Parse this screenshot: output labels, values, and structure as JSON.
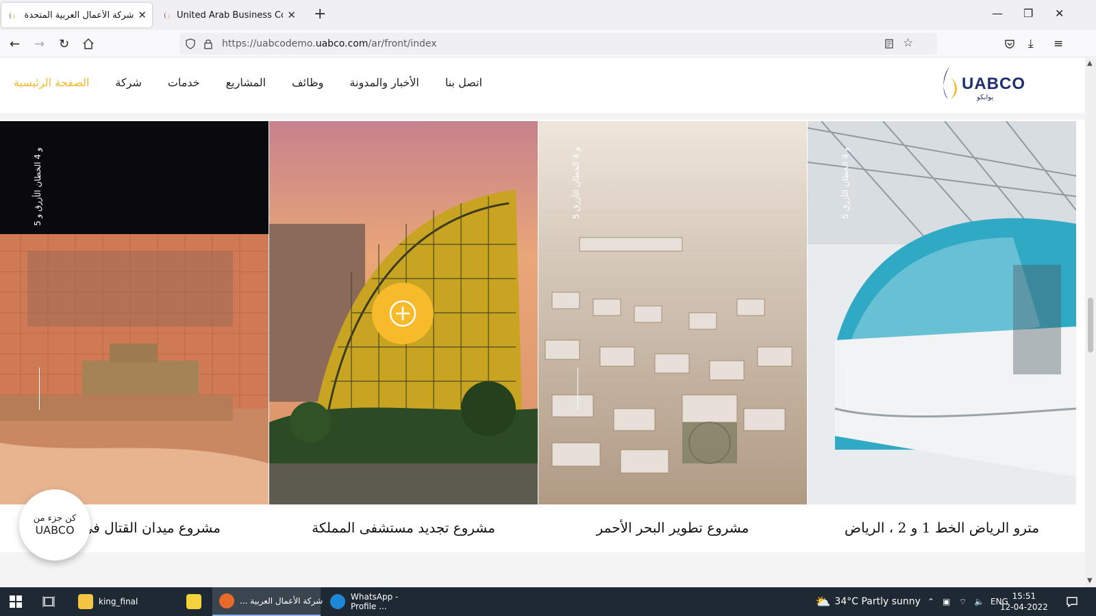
{
  "browser": {
    "tabs": [
      {
        "title": "شركة الأعمال العربية المتحدة",
        "active": true
      },
      {
        "title": "United Arab Business Company",
        "active": false
      }
    ],
    "url_prefix": "https://uabcodemo.",
    "url_domain": "uabco.com",
    "url_path": "/ar/front/index"
  },
  "site": {
    "menu": [
      "الصفحة الرئيسية",
      "شركة",
      "خدمات",
      "المشاريع",
      "وظائف",
      "الأخبار والمدونة",
      "اتصل بنا"
    ],
    "active_menu": "الصفحة الرئيسية",
    "logo": {
      "text": "UABCO",
      "subtext": "يوابكو"
    },
    "accent_color": "#f6ba2a",
    "projects": [
      {
        "title": "مترو الرياض الخط 1 و 2 ، الرياض",
        "vertical": "5 و 4 الخطان الأزرق"
      },
      {
        "title": "مشروع تطوير البحر الأحمر",
        "vertical": "5 و 4 الخطان الأزرق"
      },
      {
        "title": "مشروع تجديد مستشفى المملكة",
        "vertical": ""
      },
      {
        "title": "مشروع ميدان القتال في ال",
        "vertical": "5 و 4 الخطان الأزرق و"
      }
    ],
    "badge": {
      "line1": "كن جزء من",
      "line2": "UABCO"
    }
  },
  "taskbar": {
    "items": [
      {
        "label": "king_final",
        "icon": "folder-icon"
      },
      {
        "label": "",
        "icon": "player-icon"
      },
      {
        "label": "شركة الأعمال العربية ...",
        "icon": "firefox-icon"
      },
      {
        "label": "WhatsApp - Profile ...",
        "icon": "edge-icon"
      }
    ],
    "weather": "34°C  Partly sunny",
    "lang": "ENG",
    "time": "15:51",
    "date": "12-04-2022"
  }
}
